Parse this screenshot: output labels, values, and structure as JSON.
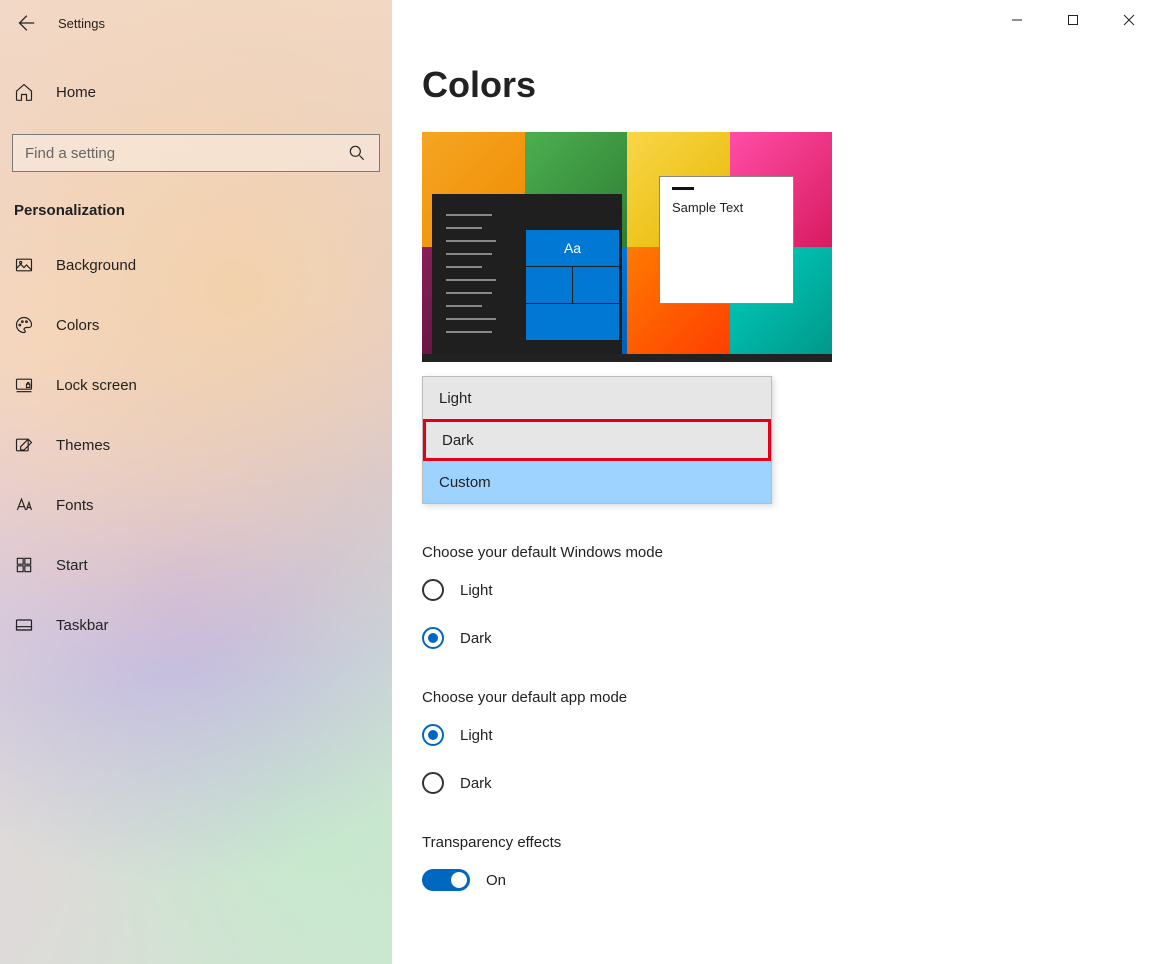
{
  "app_title": "Settings",
  "home_label": "Home",
  "search": {
    "placeholder": "Find a setting"
  },
  "section_title": "Personalization",
  "nav": [
    {
      "label": "Background"
    },
    {
      "label": "Colors"
    },
    {
      "label": "Lock screen"
    },
    {
      "label": "Themes"
    },
    {
      "label": "Fonts"
    },
    {
      "label": "Start"
    },
    {
      "label": "Taskbar"
    }
  ],
  "page": {
    "heading": "Colors",
    "preview": {
      "sample_text": "Sample Text",
      "tile_label": "Aa"
    },
    "color_dropdown": {
      "options": [
        {
          "label": "Light"
        },
        {
          "label": "Dark"
        },
        {
          "label": "Custom"
        }
      ],
      "selected": "Custom",
      "highlighted": "Dark"
    },
    "windows_mode": {
      "title": "Choose your default Windows mode",
      "options": [
        {
          "label": "Light",
          "checked": false
        },
        {
          "label": "Dark",
          "checked": true
        }
      ]
    },
    "app_mode": {
      "title": "Choose your default app mode",
      "options": [
        {
          "label": "Light",
          "checked": true
        },
        {
          "label": "Dark",
          "checked": false
        }
      ]
    },
    "transparency": {
      "title": "Transparency effects",
      "state_label": "On",
      "on": true
    }
  }
}
